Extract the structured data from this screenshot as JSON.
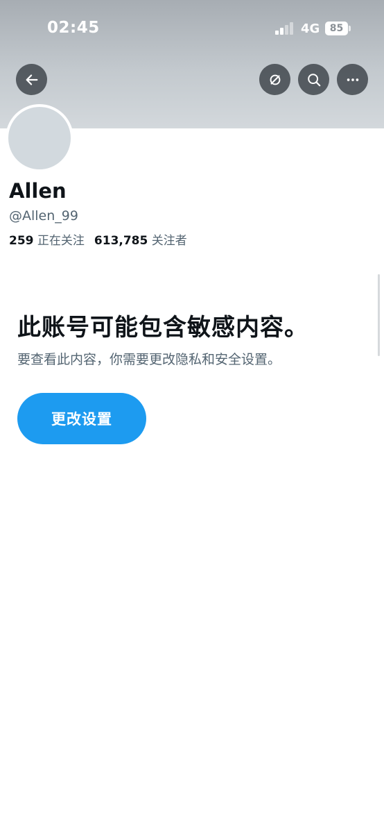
{
  "status_bar": {
    "time": "02:45",
    "network": "4G",
    "battery": "85"
  },
  "header": {
    "back_icon": "arrow-left-icon",
    "actions": [
      "no-signal-icon",
      "search-icon",
      "more-icon"
    ]
  },
  "profile": {
    "name": "Allen",
    "handle": "@Allen_99",
    "following_count": "259",
    "following_label": "正在关注",
    "followers_count": "613,785",
    "followers_label": "关注者"
  },
  "sensitive_notice": {
    "title": "此账号可能包含敏感内容。",
    "description": "要查看此内容，你需要更改隐私和安全设置。",
    "button_label": "更改设置"
  },
  "colors": {
    "accent": "#1d9bf0",
    "primary_text": "#0f1419",
    "secondary_text": "#536471",
    "avatar_placeholder": "#d2d9de"
  }
}
